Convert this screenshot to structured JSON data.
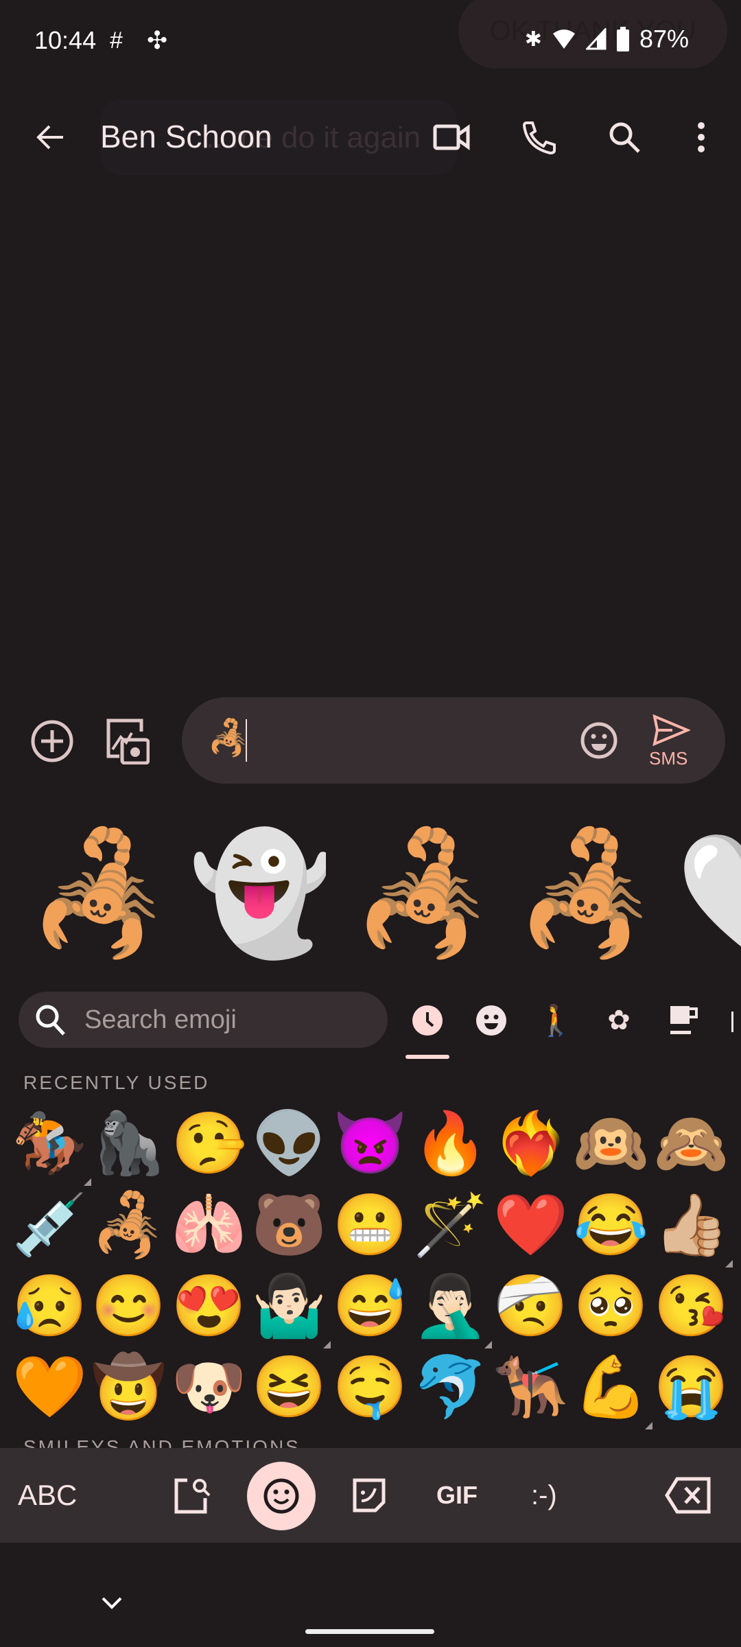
{
  "status_bar": {
    "time": "10:44",
    "battery": "87%",
    "icons": [
      "slack-icon",
      "pinwheel-icon",
      "bluetooth-icon",
      "wifi-icon",
      "signal-icon",
      "battery-icon"
    ],
    "toast": "OK THANK YOU"
  },
  "header": {
    "title": "Ben Schoon",
    "background_message": "...me do it again",
    "icons": [
      "back-arrow-icon",
      "video-call-icon",
      "phone-icon",
      "search-icon",
      "more-vert-icon"
    ]
  },
  "compose": {
    "value": "🦂",
    "send_label": "SMS",
    "accent": "#ffb4ab"
  },
  "stickers": [
    "🦂",
    "👻",
    "🦂",
    "🦂",
    "🤍"
  ],
  "emoji_search": {
    "placeholder": "Search emoji"
  },
  "categories": [
    "recent",
    "smileys",
    "people",
    "activities",
    "food"
  ],
  "recently_used_label": "RECENTLY USED",
  "recent_emojis": [
    [
      "🏇",
      "🦍",
      "🤥",
      "👽",
      "👿",
      "🔥",
      "❤️‍🔥",
      "🙉",
      "🙈"
    ],
    [
      "💉",
      "🦂",
      "🫁",
      "🐻",
      "😬",
      "🪄",
      "❤️",
      "😂",
      "👍🏼"
    ],
    [
      "😥",
      "😊",
      "😍",
      "🤷🏻‍♂️",
      "😅",
      "🤦🏻‍♂️",
      "🤕",
      "🥺",
      "😘"
    ],
    [
      "🧡",
      "🤠",
      "🐶",
      "😆",
      "🤤",
      "🐬",
      "🐕‍🦺",
      "💪",
      "😭"
    ]
  ],
  "next_section_label": "SMILEYS AND EMOTIONS",
  "keyboard_bar": {
    "abc": "ABC",
    "gif": "GIF",
    "emoticon": ":-)",
    "selected_color": "#ffd9d6"
  }
}
